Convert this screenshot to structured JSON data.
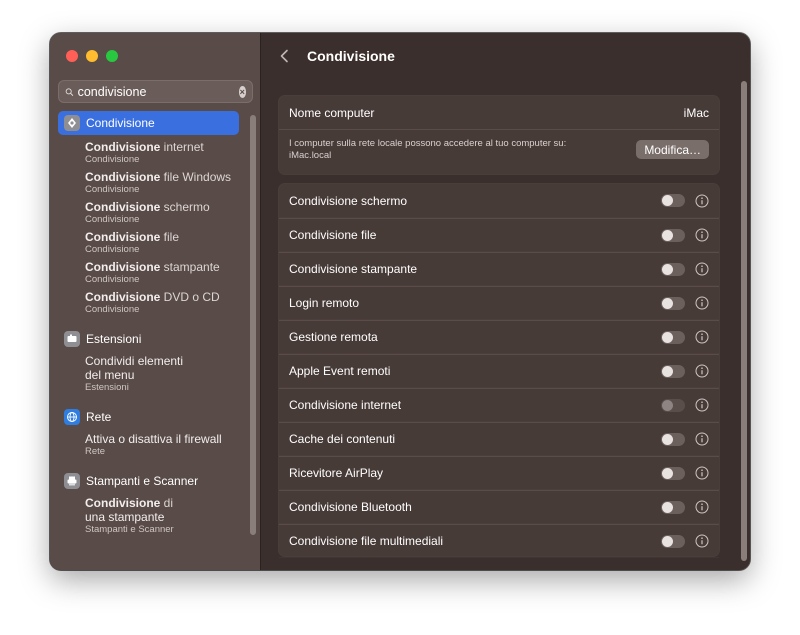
{
  "search": {
    "value": "condivisione"
  },
  "sidebar": {
    "selected": {
      "label": "Condivisione"
    },
    "sharing_results": [
      {
        "bold": "Condivisione",
        "rest": " internet",
        "caption": "Condivisione"
      },
      {
        "bold": "Condivisione",
        "rest": " file Windows",
        "caption": "Condivisione"
      },
      {
        "bold": "Condivisione",
        "rest": " schermo",
        "caption": "Condivisione"
      },
      {
        "bold": "Condivisione",
        "rest": " file",
        "caption": "Condivisione"
      },
      {
        "bold": "Condivisione",
        "rest": " stampante",
        "caption": "Condivisione"
      },
      {
        "bold": "Condivisione",
        "rest": " DVD o CD",
        "caption": "Condivisione"
      }
    ],
    "groups": [
      {
        "label": "Estensioni",
        "icon": "extensions-icon",
        "color": "#8e8e93",
        "items": [
          {
            "line1": "Condividi elementi",
            "line2": "del menu",
            "caption": "Estensioni"
          }
        ]
      },
      {
        "label": "Rete",
        "icon": "globe-icon",
        "color": "#2f7de1",
        "items": [
          {
            "line1": "Attiva o disattiva il firewall",
            "caption": "Rete"
          }
        ]
      },
      {
        "label": "Stampanti e Scanner",
        "icon": "printer-icon",
        "color": "#8e8e93",
        "items": [
          {
            "bold": "Condivisione",
            "rest": " di",
            "line2": "una stampante",
            "caption": "Stampanti e Scanner"
          }
        ]
      }
    ]
  },
  "main": {
    "title": "Condivisione",
    "computer_name_label": "Nome computer",
    "computer_name_value": "iMac",
    "description_line1": "I computer sulla rete locale possono accedere al tuo computer su:",
    "description_line2": "iMac.local",
    "modify_button": "Modifica…",
    "services": [
      {
        "label": "Condivisione schermo",
        "enabled": false
      },
      {
        "label": "Condivisione file",
        "enabled": false
      },
      {
        "label": "Condivisione stampante",
        "enabled": false
      },
      {
        "label": "Login remoto",
        "enabled": false
      },
      {
        "label": "Gestione remota",
        "enabled": false
      },
      {
        "label": "Apple Event remoti",
        "enabled": false
      },
      {
        "label": "Condivisione internet",
        "enabled": false,
        "disabled": true
      },
      {
        "label": "Cache dei contenuti",
        "enabled": false
      },
      {
        "label": "Ricevitore AirPlay",
        "enabled": false
      },
      {
        "label": "Condivisione Bluetooth",
        "enabled": false
      },
      {
        "label": "Condivisione file multimediali",
        "enabled": false
      }
    ]
  },
  "colors": {
    "accent": "#3a6fe0",
    "sidebar_bg": "#594b47",
    "content_bg": "#3a2f2c"
  }
}
